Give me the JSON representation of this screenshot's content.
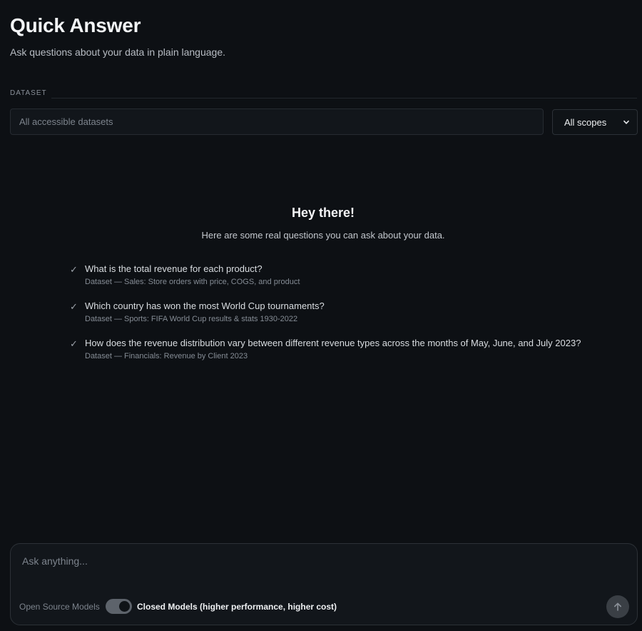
{
  "header": {
    "title": "Quick Answer",
    "subtitle": "Ask questions about your data in plain language."
  },
  "dataset": {
    "section_label": "DATASET",
    "input_placeholder": "All accessible datasets",
    "scope_selected": "All scopes"
  },
  "welcome": {
    "title": "Hey there!",
    "subtitle": "Here are some real questions you can ask about your data."
  },
  "examples": [
    {
      "check": "✓",
      "question": "What is the total revenue for each product?",
      "dataset": "Dataset — Sales: Store orders with price, COGS, and product"
    },
    {
      "check": "✓",
      "question": "Which country has won the most World Cup tournaments?",
      "dataset": "Dataset — Sports: FIFA World Cup results & stats 1930-2022"
    },
    {
      "check": "✓",
      "question": "How does the revenue distribution vary between different revenue types across the months of May, June, and July 2023?",
      "dataset": "Dataset — Financials: Revenue by Client 2023"
    }
  ],
  "composer": {
    "placeholder": "Ask anything...",
    "open_models_label": "Open Source Models",
    "closed_models_label": "Closed Models (higher performance, higher cost)",
    "toggle_state": "closed",
    "send_icon": "arrow-up-icon"
  },
  "colors": {
    "background": "#0d1014",
    "panel": "#12161b",
    "border": "#2c3137",
    "toggle": "#5d636b",
    "send_button": "#3a3f45"
  }
}
